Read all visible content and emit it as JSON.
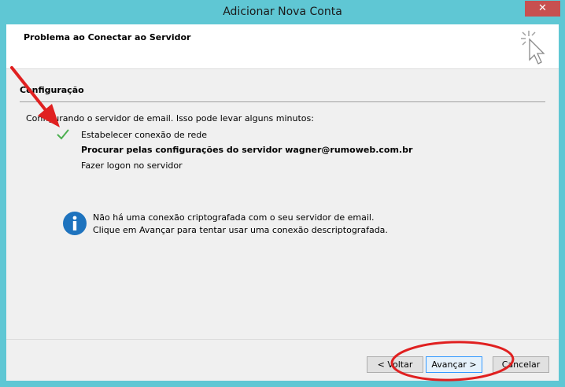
{
  "window": {
    "title": "Adicionar Nova Conta",
    "close_label": "✕"
  },
  "header": {
    "title": "Problema ao Conectar ao Servidor"
  },
  "section": {
    "title": "Configuração",
    "status": "Configurando o servidor de email. Isso pode levar alguns minutos:"
  },
  "steps": [
    {
      "label": "Estabelecer conexão de rede",
      "state": "done"
    },
    {
      "label": "Procurar pelas configurações do servidor wagner@rumoweb.com.br",
      "state": "active"
    },
    {
      "label": "Fazer logon no servidor",
      "state": "pending"
    }
  ],
  "info": {
    "line1": "Não há uma conexão criptografada com o seu servidor de email.",
    "line2": "Clique em Avançar para tentar usar uma conexão descriptografada."
  },
  "buttons": {
    "back": "< Voltar",
    "next": "Avançar >",
    "cancel": "Cancelar"
  },
  "colors": {
    "titlebar": "#5fc7d4",
    "close": "#c75050",
    "check": "#4caf50",
    "info": "#1e73be",
    "annotation": "#e02020"
  }
}
